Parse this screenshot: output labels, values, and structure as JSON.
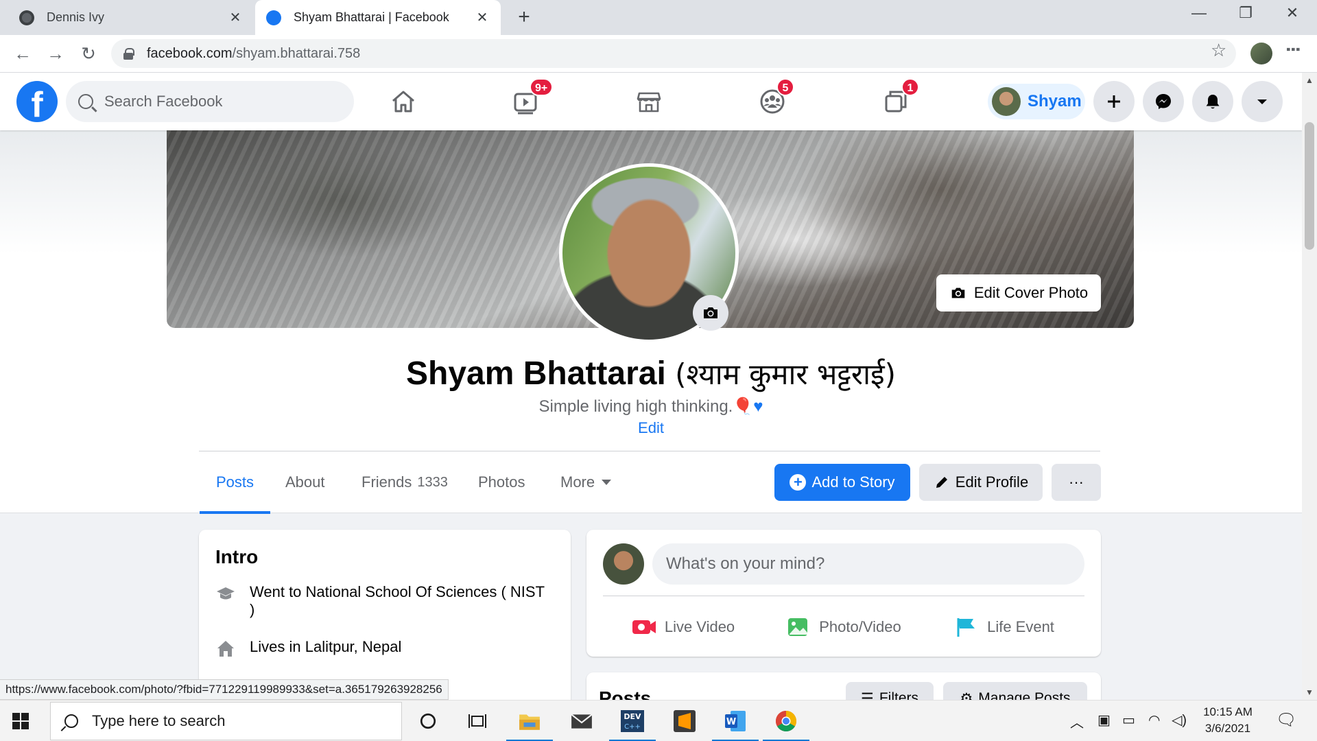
{
  "browser": {
    "tabs": [
      {
        "title": "Dennis Ivy",
        "active": false
      },
      {
        "title": "Shyam Bhattarai | Facebook",
        "active": true
      }
    ],
    "url_domain": "facebook.com",
    "url_path": "/shyam.bhattarai.758",
    "status_url": "https://www.facebook.com/photo/?fbid=771229119989933&set=a.365179263928256"
  },
  "fb_header": {
    "search_placeholder": "Search Facebook",
    "watch_badge": "9+",
    "groups_badge": "5",
    "gaming_badge": "1",
    "profile_chip_name": "Shyam"
  },
  "profile": {
    "name": "Shyam Bhattarai",
    "name_native": "(श्याम कुमार भट्टराई)",
    "bio": "Simple living high thinking.",
    "bio_edit": "Edit",
    "edit_cover_label": "Edit Cover Photo",
    "tabs": [
      {
        "label": "Posts"
      },
      {
        "label": "About"
      },
      {
        "label": "Friends",
        "count": "1333"
      },
      {
        "label": "Photos"
      },
      {
        "label": "More"
      }
    ],
    "add_story_label": "Add to Story",
    "edit_profile_label": "Edit Profile",
    "more_options_label": "···"
  },
  "intro": {
    "title": "Intro",
    "education_prefix": "Went to ",
    "education_school": "National School Of Sciences ( NIST )",
    "location_prefix": "Lives in ",
    "location": "Lalitpur, Nepal"
  },
  "composer": {
    "placeholder": "What's on your mind?",
    "actions": [
      {
        "label": "Live Video"
      },
      {
        "label": "Photo/Video"
      },
      {
        "label": "Life Event"
      }
    ]
  },
  "posts": {
    "title": "Posts",
    "filters_label": "Filters",
    "manage_label": "Manage Posts"
  },
  "taskbar": {
    "search_text": "Type here to search",
    "time": "10:15 AM",
    "date": "3/6/2021"
  },
  "colors": {
    "fb_blue": "#1877f2",
    "badge_red": "#e41e3f"
  }
}
